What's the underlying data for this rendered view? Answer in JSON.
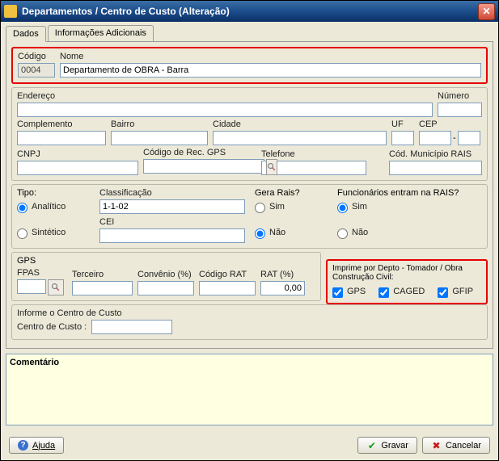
{
  "window": {
    "title": "Departamentos / Centro de Custo (Alteração)"
  },
  "tabs": {
    "dados": "Dados",
    "info": "Informações Adicionais"
  },
  "line1": {
    "codigo_lbl": "Código",
    "codigo_val": "0004",
    "nome_lbl": "Nome",
    "nome_val": "Departamento de OBRA - Barra"
  },
  "addr": {
    "endereco_lbl": "Endereço",
    "numero_lbl": "Número",
    "complemento_lbl": "Complemento",
    "bairro_lbl": "Bairro",
    "cidade_lbl": "Cidade",
    "uf_lbl": "UF",
    "cep_lbl": "CEP",
    "cep_sep": "-",
    "cnpj_lbl": "CNPJ",
    "codrecgps_lbl": "Código de Rec. GPS",
    "telefone_lbl": "Telefone",
    "codmunrais_lbl": "Cód. Município RAIS"
  },
  "tipo": {
    "grp": "Tipo:",
    "analitico": "Analítico",
    "sintetico": "Sintético",
    "class_lbl": "Classificação",
    "class_val": "1-1-02",
    "cei_lbl": "CEI",
    "rais_grp": "Gera Rais?",
    "sim": "Sim",
    "nao": "Não",
    "func_grp": "Funcionários entram na RAIS?"
  },
  "gps": {
    "grp": "GPS",
    "fpas_lbl": "FPAS",
    "terc_lbl": "Terceiro",
    "conv_lbl": "Convênio (%)",
    "codrat_lbl": "Código RAT",
    "rat_lbl": "RAT (%)",
    "rat_val": "0,00",
    "imp_grp": "Imprime por Depto - Tomador / Obra Construção Civil:",
    "cgps": "GPS",
    "ccaged": "CAGED",
    "cgfip": "GFIP"
  },
  "centro": {
    "info_lbl": "Informe o Centro de Custo",
    "cc_lbl": "Centro de Custo :"
  },
  "comment": {
    "lbl": "Comentário"
  },
  "buttons": {
    "help": "Ajuda",
    "gravar": "Gravar",
    "cancelar": "Cancelar"
  }
}
